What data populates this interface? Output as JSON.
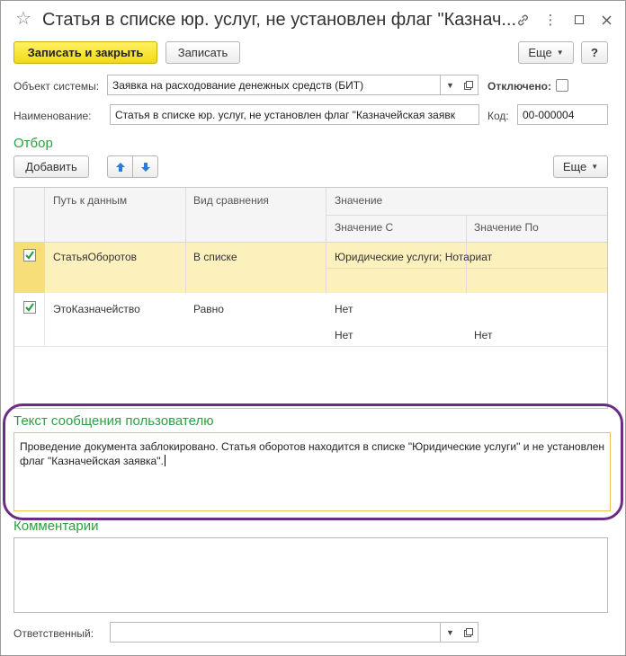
{
  "window": {
    "title": "Статья в списке юр. услуг, не установлен флаг \"Казнач..."
  },
  "toolbar": {
    "save_close_label": "Записать и закрыть",
    "save_label": "Записать",
    "more_label": "Еще",
    "help_label": "?"
  },
  "form": {
    "object_label": "Объект системы:",
    "object_value": "Заявка на расходование денежных средств (БИТ)",
    "disabled_label": "Отключено:",
    "name_label": "Наименование:",
    "name_value": "Статья в списке юр. услуг, не установлен флаг \"Казначейская заявк",
    "code_label": "Код:",
    "code_value": "00-000004"
  },
  "filter": {
    "section_title": "Отбор",
    "add_label": "Добавить",
    "more_label": "Еще",
    "columns": {
      "path": "Путь к данным",
      "comparison": "Вид сравнения",
      "value": "Значение",
      "value_from": "Значение С",
      "value_to": "Значение По"
    },
    "rows": [
      {
        "checked": true,
        "path": "СтатьяОборотов",
        "comparison": "В списке",
        "value": "Юридические услуги; Нотариат",
        "value_from": "",
        "value_to": ""
      },
      {
        "checked": true,
        "path": "ЭтоКазначейство",
        "comparison": "Равно",
        "value": "Нет",
        "value_from": "Нет",
        "value_to": "Нет"
      }
    ]
  },
  "message": {
    "section_title": "Текст сообщения пользователю",
    "text": "Проведение документа заблокировано. Статья оборотов находится в списке \"Юридические услуги\" и не установлен флаг \"Казначейская заявка\"."
  },
  "comments": {
    "section_title": "Комментарии"
  },
  "responsible": {
    "label": "Ответственный:",
    "value": ""
  },
  "colors": {
    "accent_green": "#2d9f43",
    "primary_button": "#f2d913",
    "selected_row": "#fcf0bd",
    "outline": "#6a2d84"
  }
}
